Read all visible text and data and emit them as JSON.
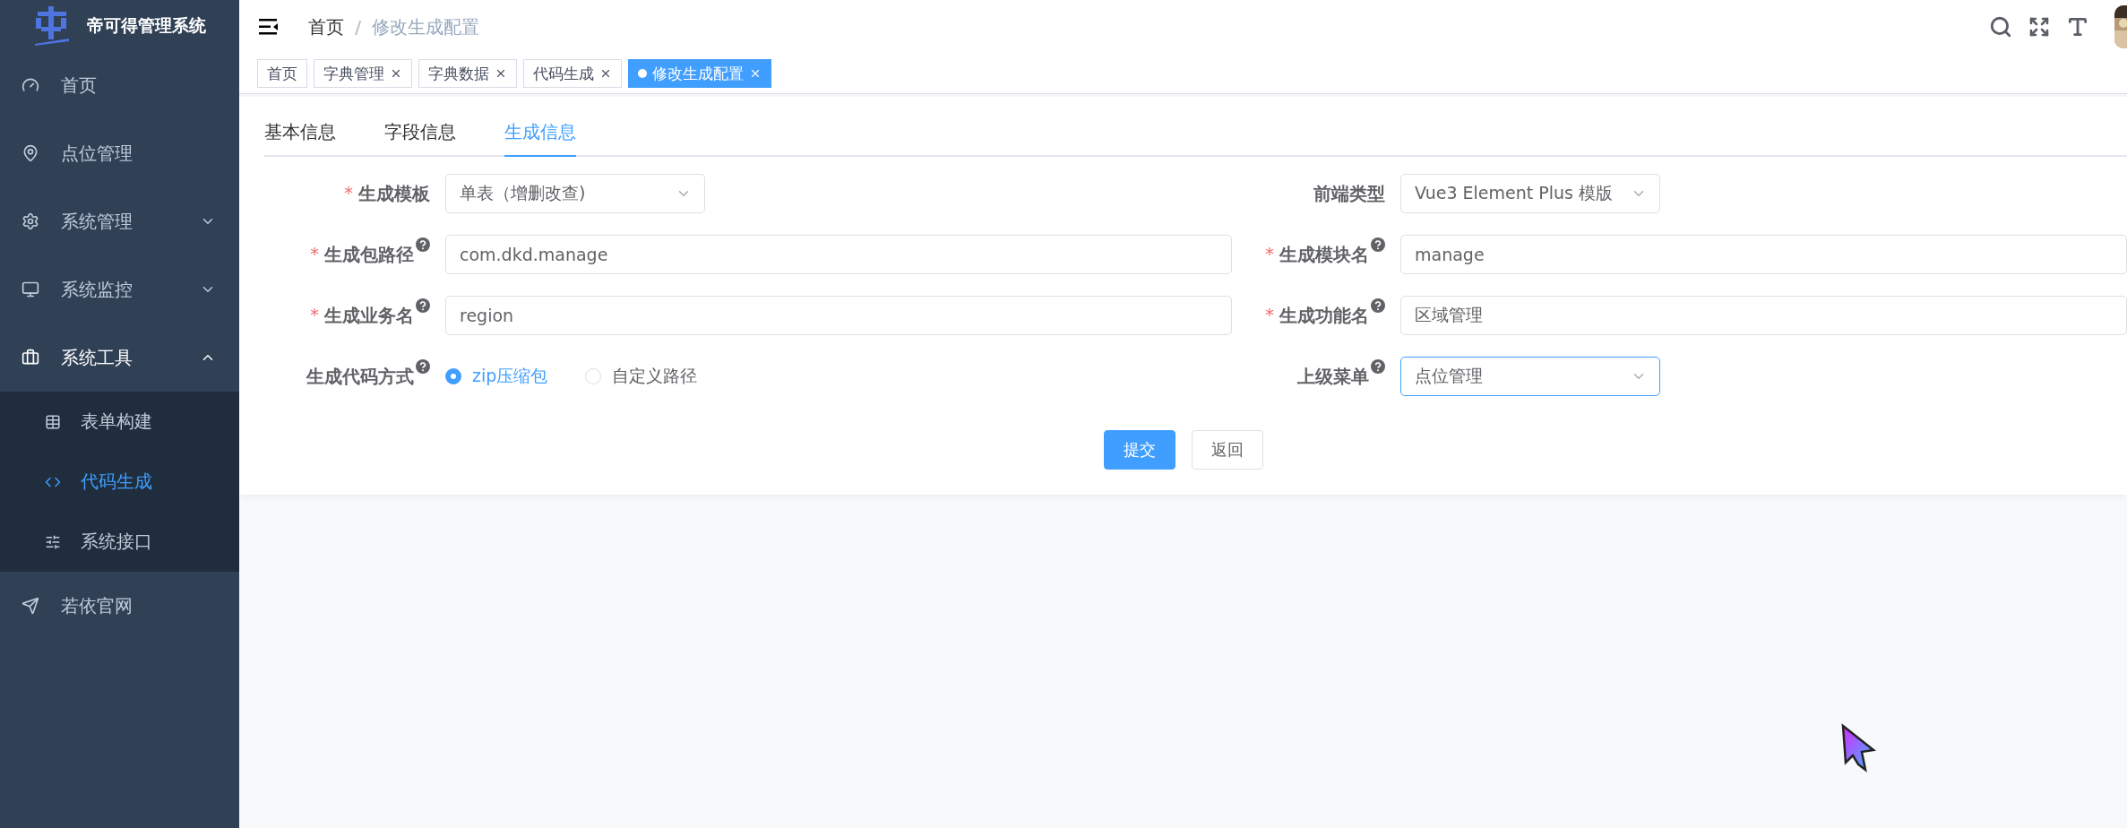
{
  "app_title": "帝可得管理系统",
  "sidebar": {
    "items": [
      {
        "label": "首页",
        "expandable": false
      },
      {
        "label": "点位管理",
        "expandable": false
      },
      {
        "label": "系统管理",
        "expandable": true,
        "expanded": false
      },
      {
        "label": "系统监控",
        "expandable": true,
        "expanded": false
      },
      {
        "label": "系统工具",
        "expandable": true,
        "expanded": true,
        "children": [
          {
            "label": "表单构建",
            "selected": false
          },
          {
            "label": "代码生成",
            "selected": true
          },
          {
            "label": "系统接口",
            "selected": false
          }
        ]
      },
      {
        "label": "若依官网",
        "expandable": false
      }
    ]
  },
  "breadcrumb": [
    {
      "label": "首页"
    },
    {
      "separator": "/",
      "label": "修改生成配置"
    }
  ],
  "tags": [
    {
      "label": "首页",
      "selected": false,
      "closable": false
    },
    {
      "label": "字典管理",
      "selected": false,
      "closable": true
    },
    {
      "label": "字典数据",
      "selected": false,
      "closable": true
    },
    {
      "label": "代码生成",
      "selected": false,
      "closable": true
    },
    {
      "label": "修改生成配置",
      "selected": true,
      "closable": true
    }
  ],
  "tabs": [
    {
      "label": "基本信息",
      "selected": false
    },
    {
      "label": "字段信息",
      "selected": false
    },
    {
      "label": "生成信息",
      "selected": true
    }
  ],
  "form": {
    "left": [
      {
        "kind": "select",
        "required_mark": "*",
        "label": "生成模板",
        "help": false,
        "value": "单表（增删改查)",
        "focused": false
      },
      {
        "kind": "input",
        "required_mark": "*",
        "label": "生成包路径",
        "help": true,
        "value": "com.dkd.manage",
        "focused": false
      },
      {
        "kind": "input",
        "required_mark": "*",
        "label": "生成业务名",
        "help": true,
        "value": "region",
        "focused": false
      },
      {
        "kind": "radio",
        "label": "生成代码方式",
        "help": true,
        "options": [
          {
            "label": "zip压缩包",
            "selected": true
          },
          {
            "label": "自定义路径",
            "selected": false
          }
        ]
      }
    ],
    "right": [
      {
        "kind": "select",
        "label": "前端类型",
        "help": false,
        "value": "Vue3 Element Plus 模版",
        "focused": false
      },
      {
        "kind": "input",
        "required_mark": "*",
        "label": "生成模块名",
        "help": true,
        "value": "manage",
        "focused": false
      },
      {
        "kind": "input",
        "required_mark": "*",
        "label": "生成功能名",
        "help": true,
        "value": "区域管理",
        "focused": false
      },
      {
        "kind": "select",
        "label": "上级菜单",
        "help": true,
        "value": "点位管理",
        "focused": true
      }
    ]
  },
  "buttons": [
    {
      "label": "提交",
      "kind": "primary"
    },
    {
      "label": "返回",
      "kind": "default"
    }
  ]
}
